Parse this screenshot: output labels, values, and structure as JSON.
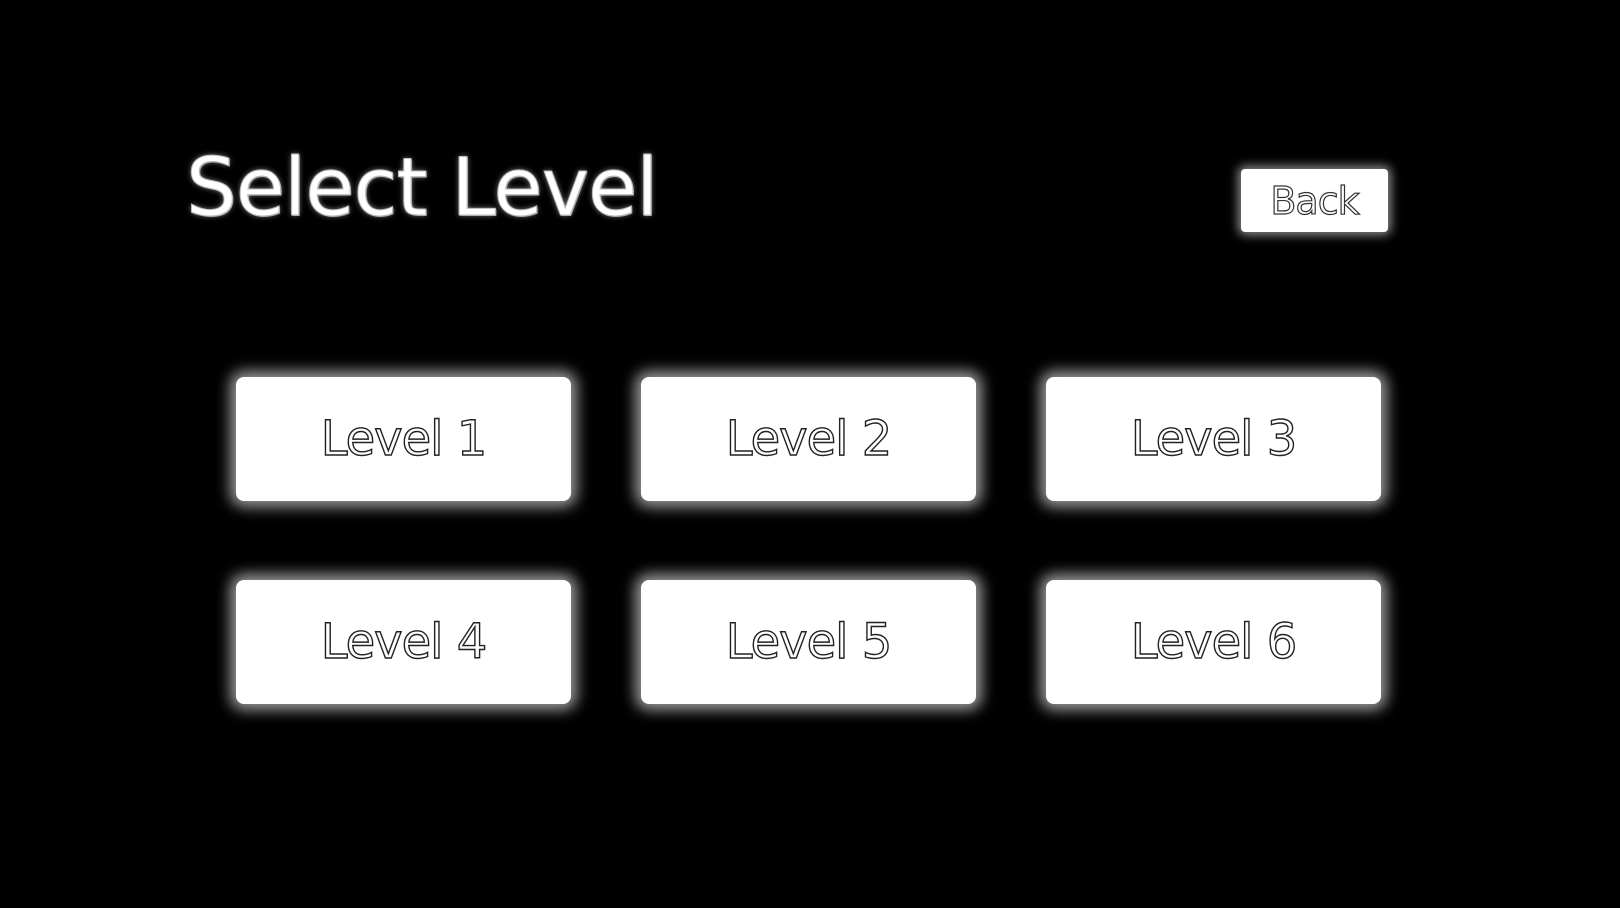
{
  "screen": {
    "title": "Select Level",
    "back_label": "Back"
  },
  "levels": [
    {
      "label": "Level 1"
    },
    {
      "label": "Level 2"
    },
    {
      "label": "Level 3"
    },
    {
      "label": "Level 4"
    },
    {
      "label": "Level 5"
    },
    {
      "label": "Level 6"
    }
  ],
  "colors": {
    "background": "#000000",
    "button": "#ffffff",
    "glow": "#ffffff"
  }
}
